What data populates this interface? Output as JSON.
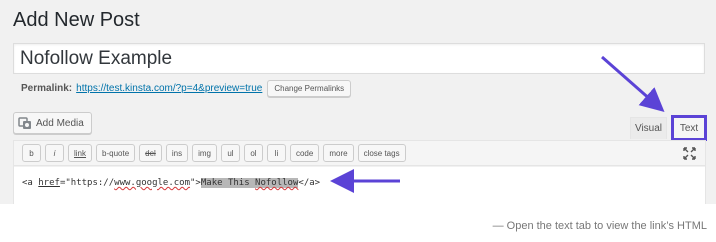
{
  "page": {
    "title": "Add New Post",
    "post_title_value": "Nofollow Example"
  },
  "permalink": {
    "label": "Permalink:",
    "url": "https://test.kinsta.com/?p=4&preview=true",
    "change_button": "Change Permalinks"
  },
  "media": {
    "add_label": "Add Media",
    "icon": "media-camera-icon"
  },
  "editor_tabs": {
    "visual": "Visual",
    "text": "Text",
    "active": "text",
    "highlight_color": "#5b43d6"
  },
  "quicktags": [
    "b",
    "i",
    "link",
    "b-quote",
    "del",
    "ins",
    "img",
    "ul",
    "ol",
    "li",
    "code",
    "more",
    "close tags"
  ],
  "editor_content": {
    "open_tag_start": "<a ",
    "href_attr": "href",
    "equals_quote": "=\"",
    "url_scheme": "https://",
    "url_host": "www.google.com",
    "close_quote": "\">",
    "selected_text_1": "Make This ",
    "selected_text_2": "Nofollow",
    "end_tag": "</a>"
  },
  "caption": "— Open the text tab to view the link’s HTML",
  "colors": {
    "arrow": "#5b43d6",
    "link": "#0073aa",
    "panel_bg": "#f1f1f1"
  }
}
